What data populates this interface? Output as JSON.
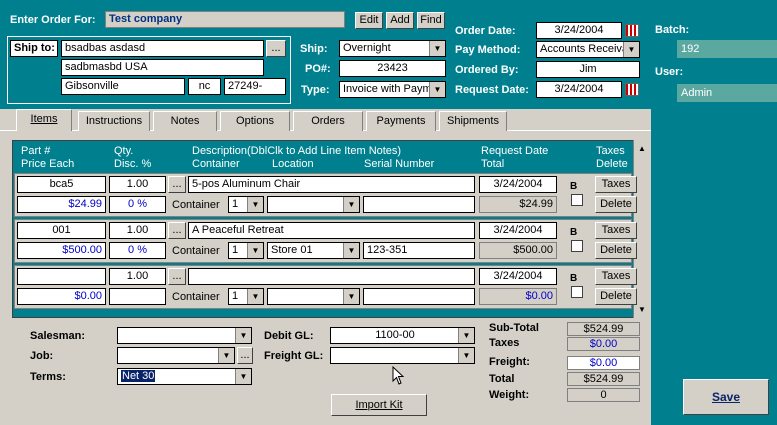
{
  "header": {
    "enter_order_label": "Enter Order For:",
    "company": "Test company",
    "edit": "Edit",
    "add": "Add",
    "find": "Find",
    "ship_to_label": "Ship to:",
    "ship_name": "bsadbas  asdasd",
    "ship_addr": "sadbmasbd   USA",
    "ship_city": "Gibsonville",
    "ship_state": "nc",
    "ship_zip": "27249-",
    "browse": "...",
    "ship_label": "Ship:",
    "ship_value": "Overnight",
    "po_label": "PO#:",
    "po_value": "23423",
    "type_label": "Type:",
    "type_value": "Invoice with Paym",
    "order_date_label": "Order Date:",
    "order_date": "3/24/2004",
    "pay_method_label": "Pay Method:",
    "pay_method": "Accounts Receiva",
    "ordered_by_label": "Ordered By:",
    "ordered_by": "Jim",
    "request_date_label": "Request Date:",
    "request_date": "3/24/2004",
    "batch_label": "Batch:",
    "batch_value": "192",
    "user_label": "User:",
    "user_value": "Admin"
  },
  "tabs": [
    "Items",
    "Instructions",
    "Notes",
    "Options",
    "Orders",
    "Payments",
    "Shipments"
  ],
  "columns": {
    "part": "Part #",
    "price": "Price Each",
    "qty": "Qty.",
    "disc": "Disc. %",
    "desc": "Description(DblClk to Add Line Item Notes)",
    "container": "Container",
    "location": "Location",
    "serial": "Serial Number",
    "request": "Request Date",
    "total": "Total",
    "taxes": "Taxes",
    "delete": "Delete"
  },
  "line_labels": {
    "container": "Container",
    "b": "B",
    "taxes_btn": "Taxes",
    "delete_btn": "Delete",
    "browse": "..."
  },
  "lines": [
    {
      "part": "bca5",
      "qty": "1.00",
      "desc": "5-pos Aluminum Chair",
      "date": "3/24/2004",
      "price": "$24.99",
      "disc": "0 %",
      "cont": "1",
      "loc": "",
      "serial": "",
      "total": "$24.99"
    },
    {
      "part": "001",
      "qty": "1.00",
      "desc": "A Peaceful Retreat",
      "date": "3/24/2004",
      "price": "$500.00",
      "disc": "0 %",
      "cont": "1",
      "loc": "Store 01",
      "serial": "123-351",
      "total": "$500.00"
    },
    {
      "part": "",
      "qty": "1.00",
      "desc": "",
      "date": "3/24/2004",
      "price": "$0.00",
      "disc": "",
      "cont": "1",
      "loc": "",
      "serial": "",
      "total": "$0.00"
    }
  ],
  "footer": {
    "salesman_label": "Salesman:",
    "job_label": "Job:",
    "terms_label": "Terms:",
    "terms_value": "Net 30",
    "debit_gl_label": "Debit GL:",
    "debit_gl_value": "1100-00",
    "freight_gl_label": "Freight GL:",
    "import_kit": "Import Kit",
    "browse": "..."
  },
  "summary": {
    "subtotal_label": "Sub-Total",
    "subtotal": "$524.99",
    "taxes_label": "Taxes",
    "taxes": "$0.00",
    "freight_label": "Freight:",
    "freight": "$0.00",
    "total_label": "Total",
    "total": "$524.99",
    "weight_label": "Weight:",
    "weight": "0"
  },
  "save_label": "Save",
  "colors": {
    "teal": "#00808f",
    "blue_text": "#0000c8"
  }
}
